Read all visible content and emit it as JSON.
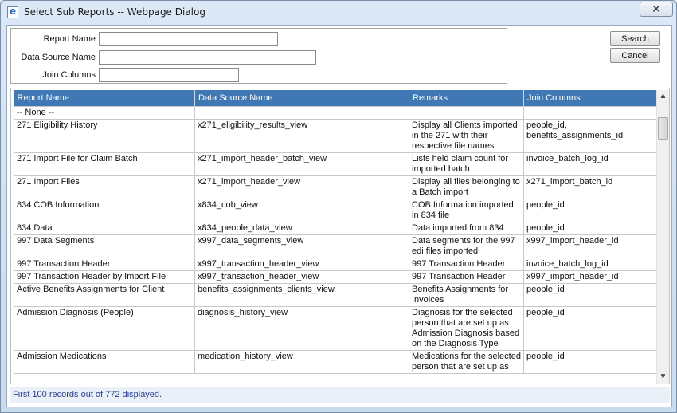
{
  "window": {
    "title": "Select Sub Reports -- Webpage Dialog",
    "close_glyph": "✕"
  },
  "filters": {
    "report_name_label": "Report Name",
    "data_source_label": "Data Source Name",
    "join_columns_label": "Join Columns",
    "report_name_value": "",
    "data_source_value": "",
    "join_columns_value": ""
  },
  "buttons": {
    "search": "Search",
    "cancel": "Cancel"
  },
  "grid": {
    "columns": [
      "Report Name",
      "Data Source Name",
      "Remarks",
      "Join Columns"
    ],
    "rows": [
      [
        "-- None --",
        "",
        "",
        ""
      ],
      [
        "271 Eligibility History",
        "x271_eligibility_results_view",
        "Display all Clients imported in the 271 with their respective file names",
        "people_id, benefits_assignments_id"
      ],
      [
        "271 Import File for Claim Batch",
        "x271_import_header_batch_view",
        "Lists held claim count for imported batch",
        "invoice_batch_log_id"
      ],
      [
        "271 Import Files",
        "x271_import_header_view",
        "Display all files belonging to a Batch import",
        "x271_import_batch_id"
      ],
      [
        "834 COB Information",
        "x834_cob_view",
        "COB Information imported in 834 file",
        "people_id"
      ],
      [
        "834 Data",
        "x834_people_data_view",
        "Data imported from 834",
        "people_id"
      ],
      [
        "997 Data Segments",
        "x997_data_segments_view",
        "Data segments for the 997 edi files imported",
        "x997_import_header_id"
      ],
      [
        "997 Transaction Header",
        "x997_transaction_header_view",
        "997 Transaction Header",
        "invoice_batch_log_id"
      ],
      [
        "997 Transaction Header by Import File",
        "x997_transaction_header_view",
        "997 Transaction Header",
        "x997_import_header_id"
      ],
      [
        "Active Benefits Assignments for Client",
        "benefits_assignments_clients_view",
        "Benefits Assignments for Invoices",
        "people_id"
      ],
      [
        "Admission Diagnosis (People)",
        "diagnosis_history_view",
        "Diagnosis for the selected person that are set up as Admission Diagnosis based on the Diagnosis Type",
        "people_id"
      ],
      [
        "Admission Medications",
        "medication_history_view",
        "Medications for the selected person that are set up as",
        "people_id"
      ]
    ]
  },
  "status": {
    "text": "First 100 records out of 772 displayed."
  },
  "colors": {
    "header_bg": "#3f78b5",
    "status_text": "#2a3d9c"
  }
}
